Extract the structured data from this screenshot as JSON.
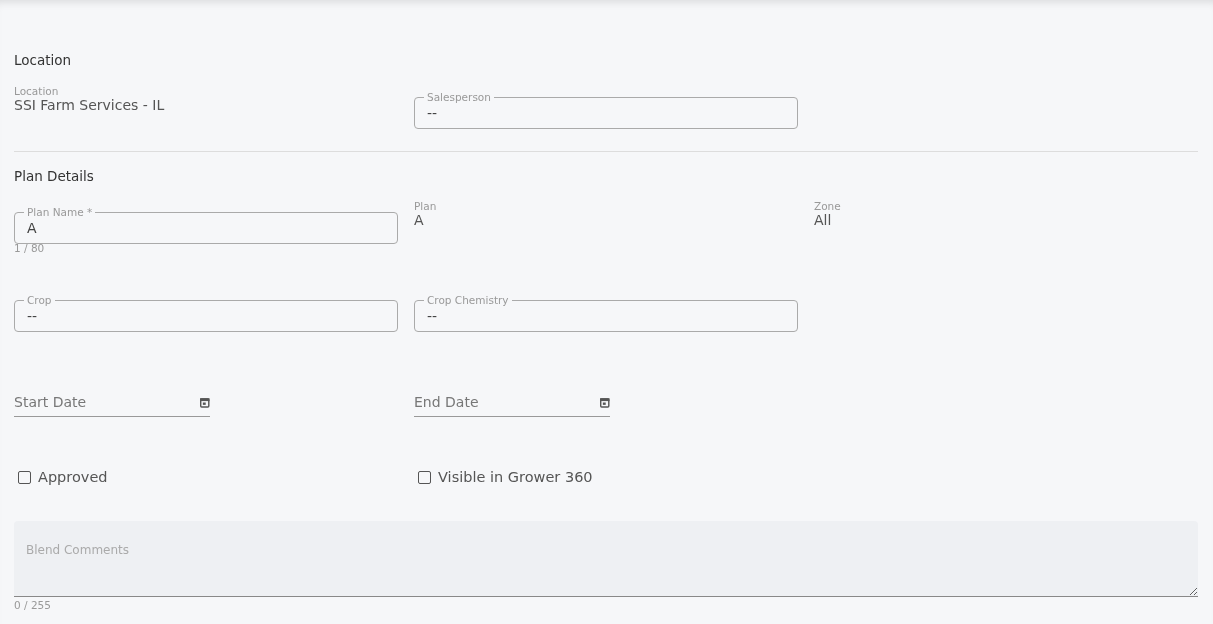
{
  "location_section": {
    "heading": "Location",
    "location": {
      "label": "Location",
      "value": "SSI Farm Services - IL"
    },
    "salesperson": {
      "label": "Salesperson",
      "value": "--"
    }
  },
  "plan_details": {
    "heading": "Plan Details",
    "plan_name": {
      "label": "Plan Name *",
      "value": "A",
      "counter": "1 / 80"
    },
    "plan": {
      "label": "Plan",
      "value": "A"
    },
    "zone": {
      "label": "Zone",
      "value": "All"
    },
    "crop": {
      "label": "Crop",
      "value": "--"
    },
    "crop_chemistry": {
      "label": "Crop Chemistry",
      "value": "--"
    },
    "start_date": {
      "placeholder": "Start Date"
    },
    "end_date": {
      "placeholder": "End Date"
    },
    "checkboxes": [
      {
        "label": "Approved",
        "checked": false
      },
      {
        "label": "Visible in Grower 360",
        "checked": false
      }
    ],
    "blend_comments": {
      "placeholder": "Blend Comments",
      "counter": "0 / 255"
    }
  }
}
